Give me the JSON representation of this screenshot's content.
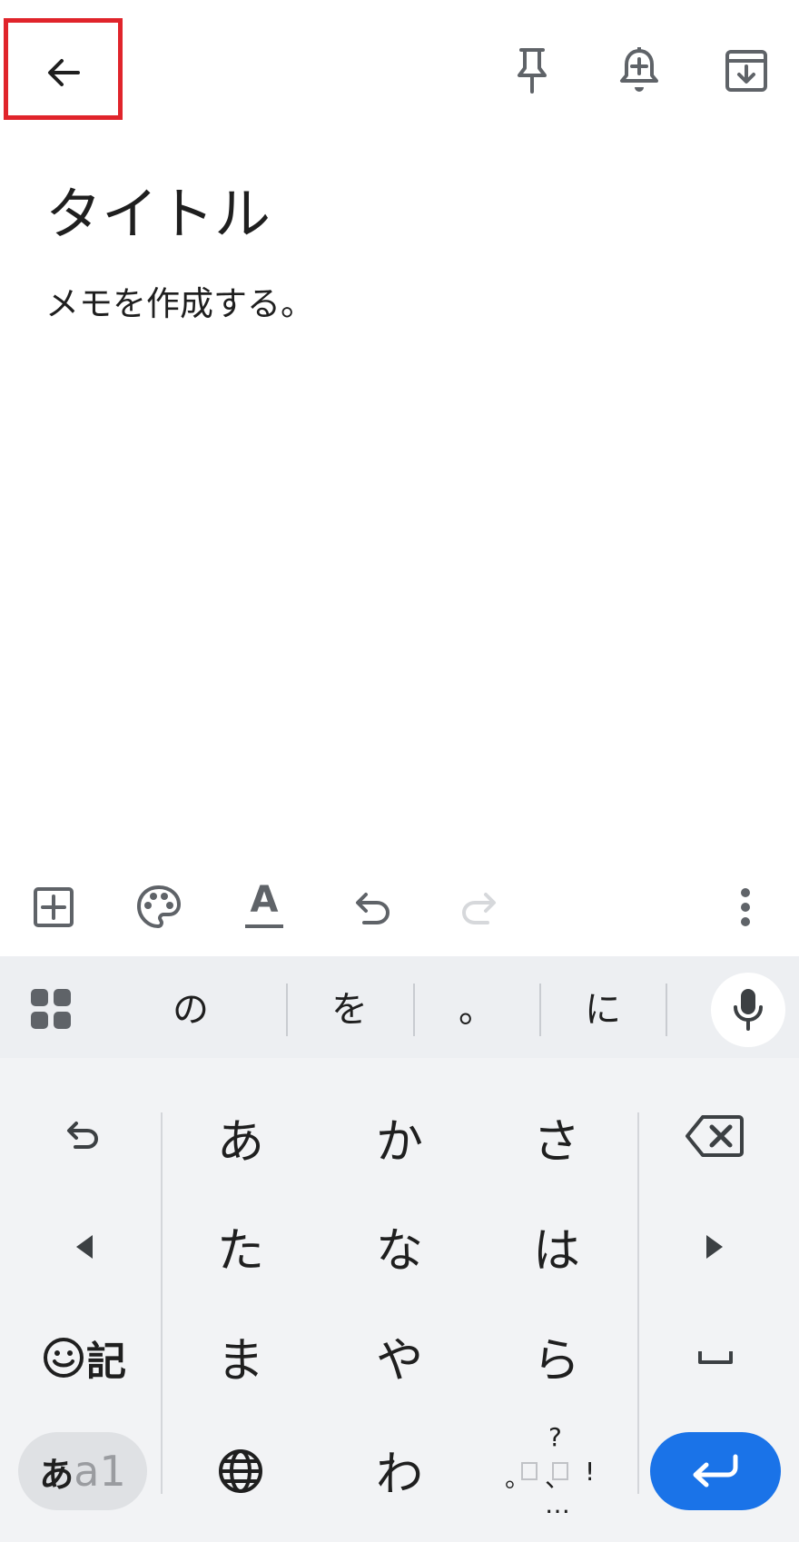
{
  "top_bar": {
    "back_icon": "arrow-left-icon",
    "pin_icon": "pin-icon",
    "reminder_icon": "bell-plus-icon",
    "archive_icon": "archive-icon"
  },
  "note": {
    "title": "タイトル",
    "body": "メモを作成する。"
  },
  "editor_toolbar": {
    "add_icon": "add-box-icon",
    "palette_icon": "palette-icon",
    "text_format_icon": "text-format-icon",
    "text_format_label": "A",
    "undo_icon": "undo-icon",
    "redo_icon": "redo-icon",
    "more_icon": "more-vert-icon"
  },
  "keyboard": {
    "suggestions": [
      "の",
      "を",
      "。",
      "に"
    ],
    "rows": [
      [
        "あ",
        "か",
        "さ"
      ],
      [
        "た",
        "な",
        "は"
      ],
      [
        "ま",
        "や",
        "ら"
      ],
      [
        "わ"
      ]
    ],
    "punct_key": {
      "top": "?",
      "left": "。",
      "mid": "、",
      "right": "!",
      "bottom": "…"
    },
    "symbol_key_label": "記",
    "mode_key": {
      "primary": "あ",
      "secondary": "a1"
    },
    "accent_color": "#1a73e8"
  }
}
